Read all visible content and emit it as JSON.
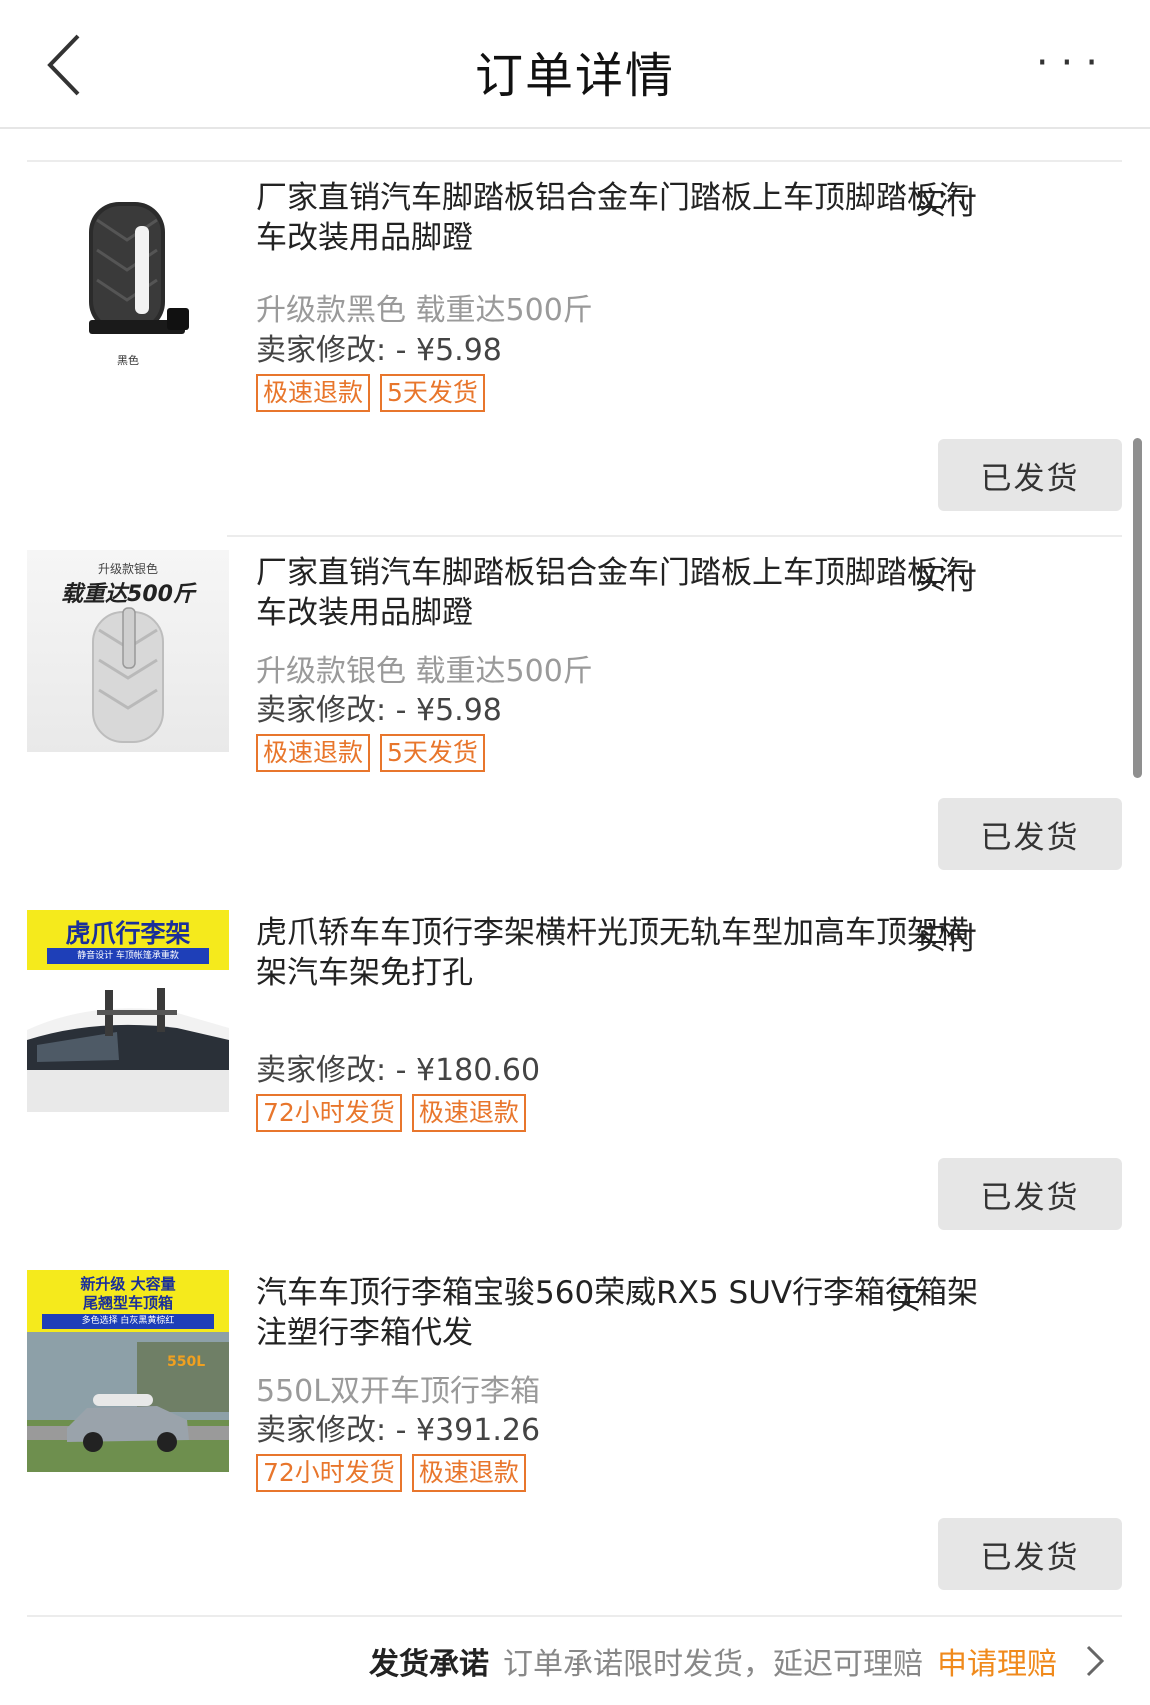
{
  "header": {
    "title": "订单详情",
    "more": "···"
  },
  "items": [
    {
      "title": "厂家直销汽车脚踏板铝合金车门踏板上车顶脚踏板汽车改装用品脚蹬",
      "cut_text": "实付",
      "spec": "升级款黑色 载重达500斤",
      "price": "卖家修改: - ¥5.98",
      "tags": [
        "极速退款",
        "5天发货"
      ],
      "button": "已发货",
      "thumb_caption": "黑色"
    },
    {
      "title": "厂家直销汽车脚踏板铝合金车门踏板上车顶脚踏板汽车改装用品脚蹬",
      "cut_text": "实付",
      "spec": "升级款银色 载重达500斤",
      "price": "卖家修改: - ¥5.98",
      "tags": [
        "极速退款",
        "5天发货"
      ],
      "button": "已发货",
      "thumb_top": "升级款银色",
      "thumb_main": "载重达500斤"
    },
    {
      "title": "虎爪轿车车顶行李架横杆光顶无轨车型加高车顶架横架汽车架免打孔",
      "cut_text": "实付",
      "spec": "",
      "price": "卖家修改: - ¥180.60",
      "tags": [
        "72小时发货",
        "极速退款"
      ],
      "button": "已发货",
      "thumb_title": "虎爪行李架",
      "thumb_sub": "静音设计 车顶帐篷承重款"
    },
    {
      "title": "汽车车顶行李箱宝骏560荣威RX5 SUV行李箱行箱架 注塑行李箱代发",
      "cut_text": "实",
      "spec": "550L双开车顶行李箱",
      "price": "卖家修改: - ¥391.26",
      "tags": [
        "72小时发货",
        "极速退款"
      ],
      "button": "已发货",
      "thumb_title1": "新升级 大容量",
      "thumb_title2": "尾翘型车顶箱",
      "thumb_sub": "多色选择 白灰黑黄棕红",
      "thumb_badge": "550L"
    }
  ],
  "footer": {
    "label": "发货承诺",
    "text": "订单承诺限时发货，延迟可理赔",
    "link": "申请理赔"
  },
  "colors": {
    "accent": "#e8762c",
    "link": "#f08a1c",
    "button_bg": "#e6e6e6"
  }
}
